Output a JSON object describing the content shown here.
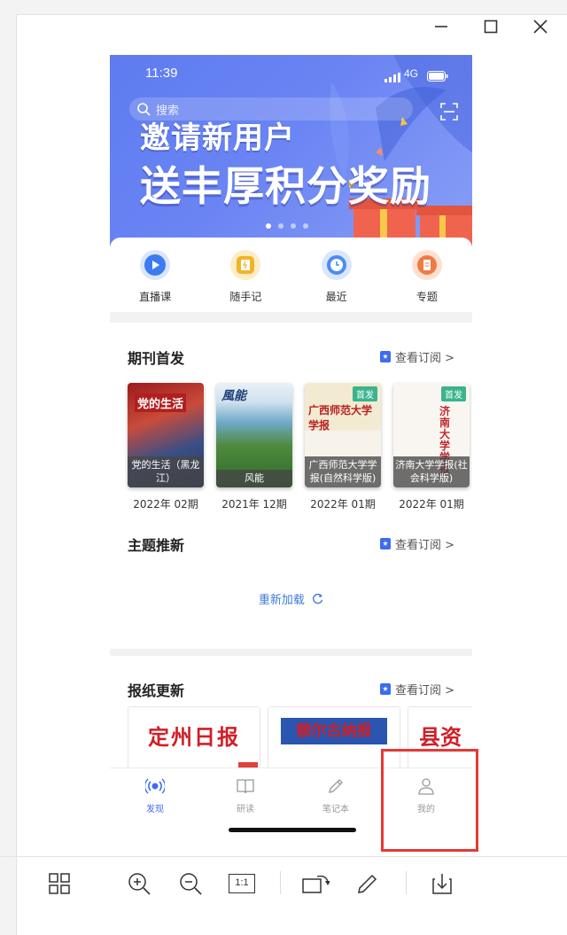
{
  "window": {
    "minimize_glyph": "—",
    "maximize_glyph": "☐",
    "close_glyph": "✕"
  },
  "status_bar": {
    "time": "11:39",
    "network": "4G"
  },
  "banner": {
    "search_placeholder": "搜索",
    "headline_line1": "邀请新用户",
    "headline_line2": "送丰厚积分奖励",
    "colors": {
      "background": "#6a84f3",
      "gift": "#f0644f"
    }
  },
  "quick_actions": [
    {
      "label": "直播课",
      "icon": "play-icon",
      "color": "#3d7cf0"
    },
    {
      "label": "随手记",
      "icon": "note-icon",
      "color": "#f0b429"
    },
    {
      "label": "最近",
      "icon": "clock-icon",
      "color": "#4a8cf5"
    },
    {
      "label": "专题",
      "icon": "topic-icon",
      "color": "#f07a45"
    }
  ],
  "periodicals": {
    "title": "期刊首发",
    "link": "查看订阅 >",
    "items": [
      {
        "caption": "党的生活（黑龙江）",
        "issue": "2022年 02期",
        "cover_text": "党的生活",
        "badge": ""
      },
      {
        "caption": "风能",
        "issue": "2021年 12期",
        "cover_text": "風能",
        "badge": ""
      },
      {
        "caption": "广西师范大学学报(自然科学版)",
        "issue": "2022年 01期",
        "cover_text": "广西师范大学学报",
        "badge": "首发"
      },
      {
        "caption": "济南大学学报(社会科学版)",
        "issue": "2022年 01期",
        "cover_text": "济南大学学报",
        "badge": "首发"
      }
    ]
  },
  "topics": {
    "title": "主题推新",
    "link": "查看订阅 >",
    "reload": "重新加载"
  },
  "newspapers": {
    "title": "报纸更新",
    "link": "查看订阅 >",
    "items": [
      {
        "name": "定州日报"
      },
      {
        "name": "额尔古纳报"
      },
      {
        "name": "县资"
      }
    ]
  },
  "tabbar": [
    {
      "label": "发现",
      "active": true
    },
    {
      "label": "研读",
      "active": false
    },
    {
      "label": "笔记本",
      "active": false
    },
    {
      "label": "我的",
      "active": false
    }
  ],
  "toolbar": {
    "actual_size_label": "1:1"
  }
}
